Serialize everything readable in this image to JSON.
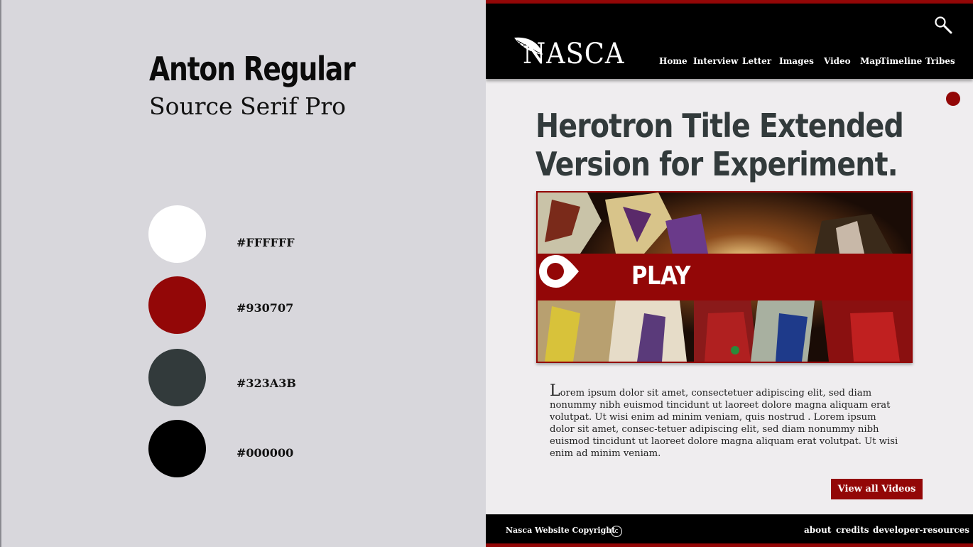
{
  "style_guide": {
    "heading_font": "Anton Regular",
    "body_font": "Source Serif Pro",
    "swatches": [
      {
        "label": "#FFFFFF",
        "color": "#FFFFFF"
      },
      {
        "label": "#930707",
        "color": "#930707"
      },
      {
        "label": "#323A3B",
        "color": "#323A3B"
      },
      {
        "label": "#000000",
        "color": "#000000"
      }
    ]
  },
  "site": {
    "logo_text": "NASCA",
    "search_icon": "search-icon",
    "nav": [
      "Home",
      "Interview",
      "Letter",
      "Images",
      "Video",
      "Map",
      "Timeline",
      "Tribes"
    ],
    "title_line1": "Herotron Title Extended",
    "title_line2": "Version for Experiment.",
    "video": {
      "play_label": "PLAY",
      "play_icon": "play-icon"
    },
    "body_dropcap": "L",
    "body_text": "orem ipsum dolor sit amet, consectetuer adipiscing elit, sed diam nonummy nibh euismod tincidunt ut laoreet dolore magna aliquam erat volutpat. Ut wisi enim ad minim veniam, quis nostrud . Lorem ipsum dolor sit amet, consec-tetuer adipiscing elit, sed diam nonummy nibh euismod tincidunt ut laoreet dolore magna aliquam erat volutpat. Ut wisi enim ad minim veniam.",
    "view_all_label": "View all Videos",
    "footer": {
      "copyright": "Nasca Website Copyright",
      "copyright_symbol": "c",
      "links": [
        "about",
        "credits",
        "developer-resources"
      ]
    },
    "colors": {
      "accent": "#930707",
      "title": "#323A3B",
      "header": "#000000"
    }
  }
}
